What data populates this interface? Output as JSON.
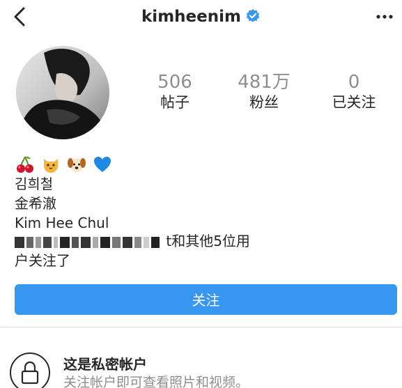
{
  "header": {
    "username": "kimheenim",
    "back_icon": "chevron-left-icon",
    "verified_icon": "verified-badge-icon",
    "more_icon": "more-horizontal-icon",
    "accent_color": "#3897f0"
  },
  "stats": [
    {
      "value": "506",
      "label": "帖子"
    },
    {
      "value": "481万",
      "label": "粉丝"
    },
    {
      "value": "0",
      "label": "已关注"
    }
  ],
  "bio": {
    "emojis": [
      "cherries",
      "cat-face",
      "dog-face",
      "blue-heart"
    ],
    "line1": "김희철",
    "line2": "金希澈",
    "line3": "Kim Hee Chul"
  },
  "followed_by": {
    "tail": "t和其他5位用",
    "line2": "户关注了"
  },
  "follow_button": {
    "label": "关注"
  },
  "private": {
    "title": "这是私密帐户",
    "subtitle": "关注帐户即可查看照片和视频。"
  }
}
